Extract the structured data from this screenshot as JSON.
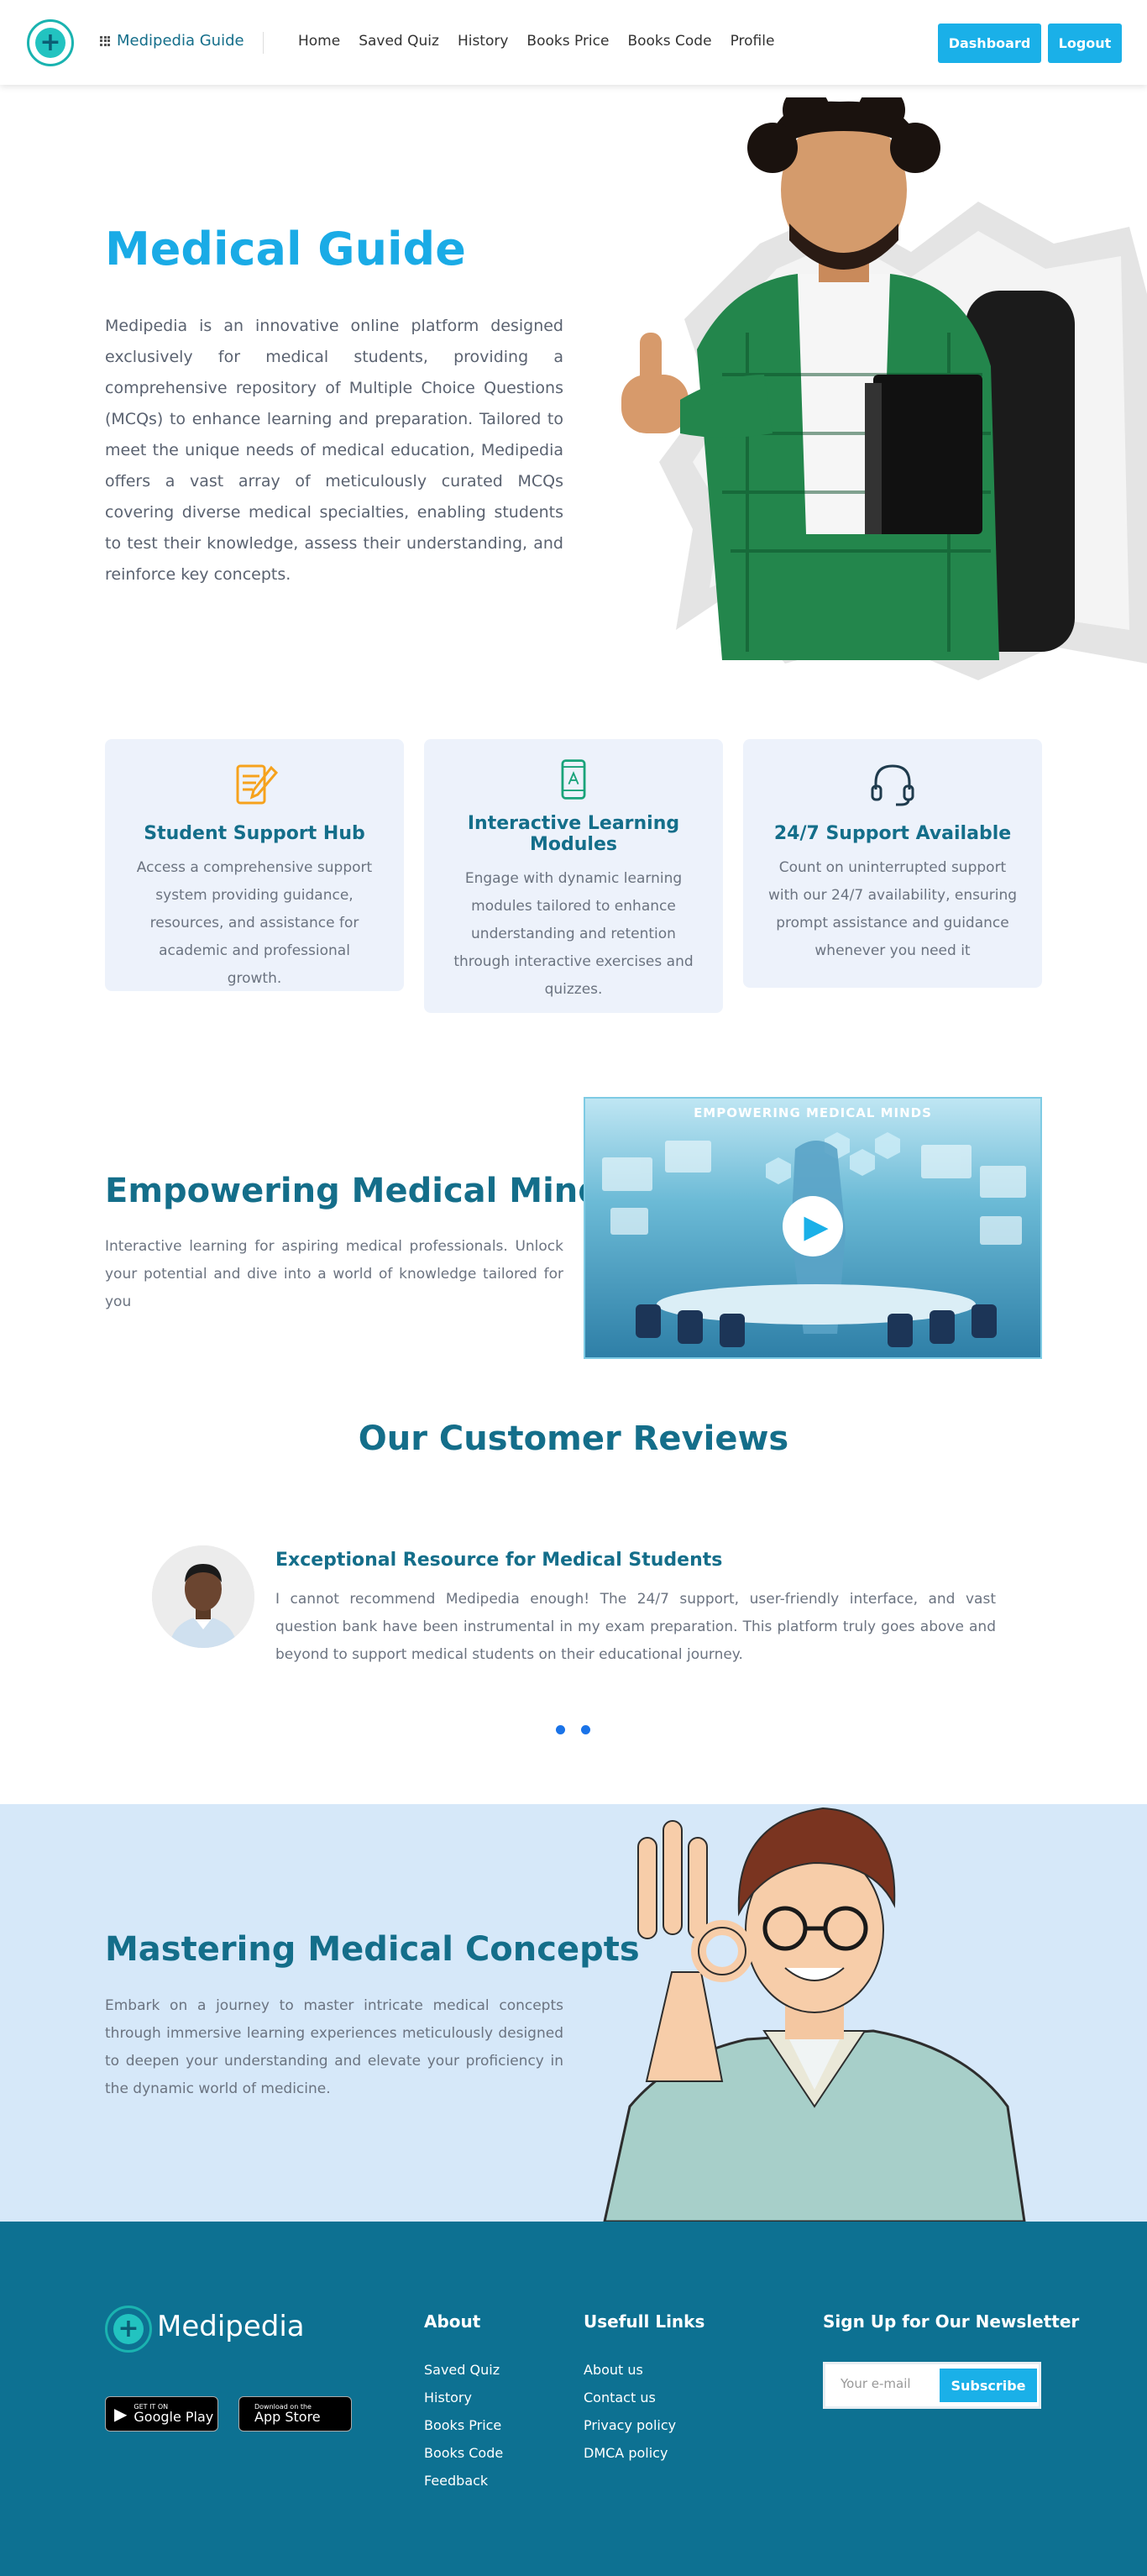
{
  "header": {
    "brand": "Medipedia Guide",
    "nav": [
      "Home",
      "Saved Quiz",
      "History",
      "Books Price",
      "Books Code",
      "Profile"
    ],
    "dashboard": "Dashboard",
    "logout": "Logout"
  },
  "hero": {
    "title": "Medical Guide",
    "text": "Medipedia is an innovative online platform designed exclusively for medical students, providing a comprehensive repository of Multiple Choice Questions (MCQs) to enhance learning and preparation. Tailored to meet the unique needs of medical education, Medipedia offers a vast array of meticulously curated MCQs covering diverse medical specialties, enabling students to test their knowledge, assess their understanding, and reinforce key concepts."
  },
  "features": [
    {
      "icon": "document-pen-icon",
      "title": "Student Support Hub",
      "text": "Access a comprehensive support system providing guidance, resources, and assistance for academic and professional growth."
    },
    {
      "icon": "mobile-book-icon",
      "title": "Interactive Learning Modules",
      "text": "Engage with dynamic learning modules tailored to enhance understanding and retention through interactive exercises and quizzes."
    },
    {
      "icon": "headset-icon",
      "title": "24/7 Support Available",
      "text": "Count on uninterrupted support with our 24/7 availability, ensuring prompt assistance and guidance whenever you need it"
    }
  ],
  "empower": {
    "title": "Empowering Medical Minds",
    "text": "Interactive learning for aspiring medical professionals. Unlock your potential and dive into a world of knowledge tailored for you",
    "video_caption": "EMPOWERING MEDICAL MINDS"
  },
  "reviews": {
    "title": "Our Customer Reviews",
    "heading": "Exceptional Resource for Medical Students",
    "text": "I cannot recommend Medipedia enough! The 24/7 support, user-friendly interface, and vast question bank have been instrumental in my exam preparation. This platform truly goes above and beyond to support medical students on their educational journey."
  },
  "mastering": {
    "title": "Mastering Medical Concepts",
    "text": "Embark on a journey to master intricate medical concepts through immersive learning experiences meticulously designed to deepen your understanding and elevate your proficiency in the dynamic world of medicine."
  },
  "footer": {
    "brand": "Medipedia",
    "google_small": "GET IT ON",
    "google_big": "Google Play",
    "apple_small": "Download on the",
    "apple_big": "App Store",
    "about_heading": "About",
    "about_links": [
      "Saved Quiz",
      "History",
      "Books Price",
      "Books Code",
      "Feedback"
    ],
    "useful_heading": "Usefull Links",
    "useful_links": [
      "About us",
      "Contact us",
      "Privacy policy",
      "DMCA policy"
    ],
    "newsletter_heading": "Sign Up for Our Newsletter",
    "email_placeholder": "Your e-mail",
    "subscribe": "Subscribe"
  },
  "colors": {
    "accent": "#1ab0e8",
    "heading": "#146e8a",
    "footer_bg": "#0d7192",
    "mastering_bg": "#d6e8f9",
    "feature_bg": "#edf2fb"
  }
}
